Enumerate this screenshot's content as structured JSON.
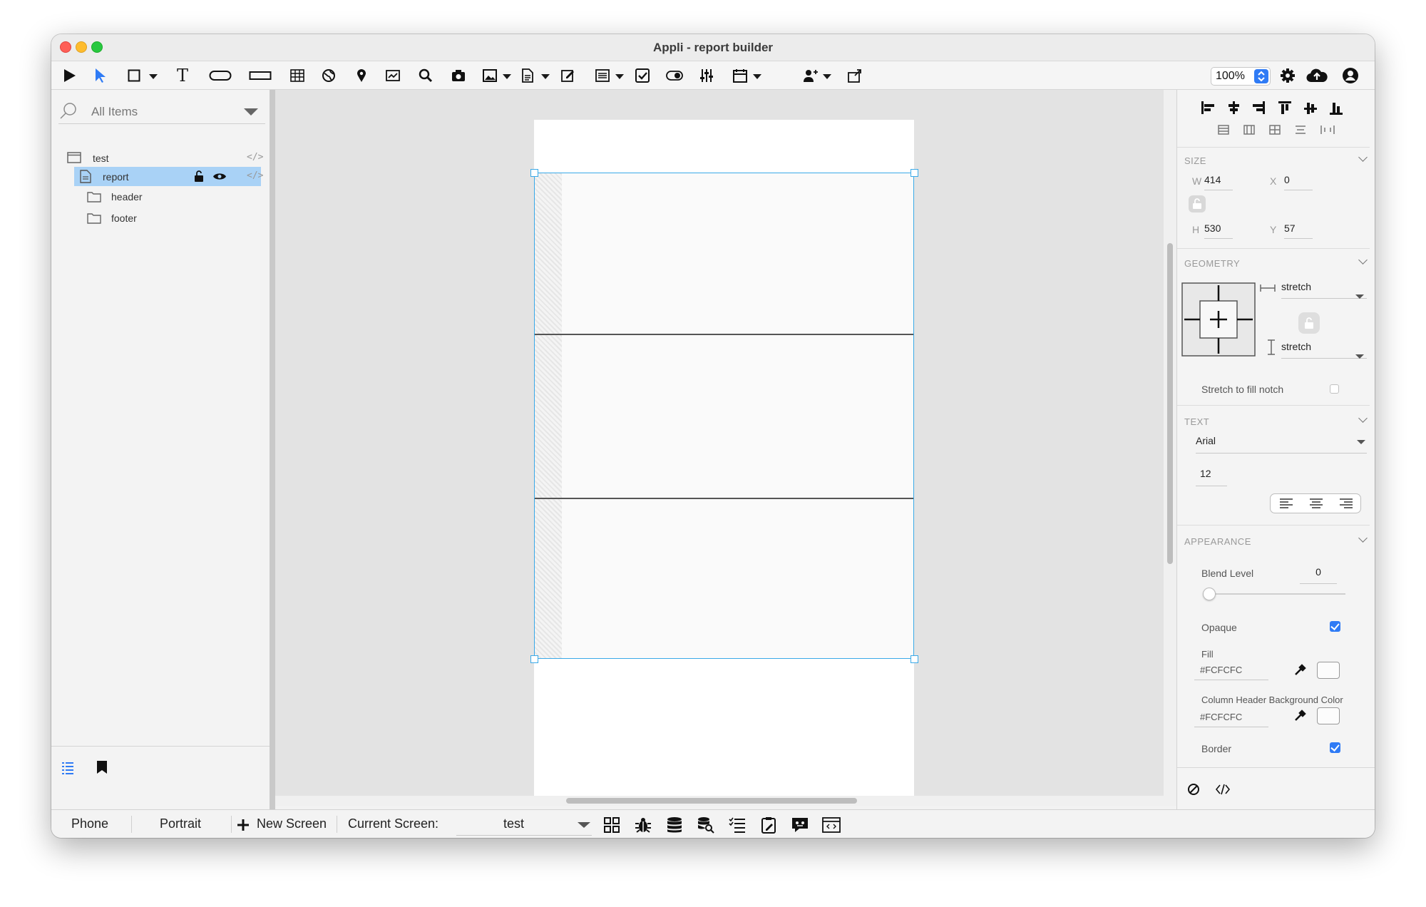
{
  "window": {
    "title": "Appli - report builder"
  },
  "toolbar": {
    "zoom": "100%",
    "tools": [
      "play-icon",
      "pointer-icon",
      "rectangle-icon",
      "text-icon",
      "button-icon",
      "input-icon",
      "table-icon",
      "globe-icon",
      "map-pin-icon",
      "chart-icon",
      "search-icon",
      "camera-icon",
      "image-icon",
      "document-icon",
      "edit-icon",
      "list-icon",
      "checkbox-icon",
      "toggle-icon",
      "sliders-icon",
      "calendar-icon",
      "add-user-icon",
      "share-icon"
    ],
    "right_icons": [
      "gear-icon",
      "cloud-upload-icon",
      "user-icon"
    ]
  },
  "left_panel": {
    "search_placeholder": "All Items",
    "tree": [
      {
        "label": "test",
        "icon": "window-icon"
      },
      {
        "label": "report",
        "icon": "document-icon",
        "selected": true
      },
      {
        "label": "header",
        "icon": "folder-icon"
      },
      {
        "label": "footer",
        "icon": "folder-icon"
      }
    ],
    "code_symbol": "</>"
  },
  "inspector": {
    "size": {
      "title": "SIZE",
      "w_label": "W",
      "w": "414",
      "x_label": "X",
      "x": "0",
      "h_label": "H",
      "h": "530",
      "y_label": "Y",
      "y": "57"
    },
    "geometry": {
      "title": "GEOMETRY",
      "horizontal": "stretch",
      "vertical": "stretch",
      "notch_label": "Stretch to fill notch",
      "notch": false
    },
    "text": {
      "title": "TEXT",
      "font": "Arial",
      "size": "12"
    },
    "appearance": {
      "title": "APPEARANCE",
      "blend_label": "Blend Level",
      "blend": "0",
      "opaque_label": "Opaque",
      "opaque": true,
      "fill_label": "Fill",
      "fill": "#FCFCFC",
      "header_bg_label": "Column Header Background Color",
      "header_bg": "#FCFCFC",
      "border_label": "Border",
      "border": true
    }
  },
  "bottom_bar": {
    "device": "Phone",
    "orientation": "Portrait",
    "new_screen": "New Screen",
    "current_screen_label": "Current Screen:",
    "current_screen": "test"
  },
  "colors": {
    "accent": "#2f7bf5",
    "selection": "#a9d2f6",
    "frame": "#3aa9e8"
  }
}
